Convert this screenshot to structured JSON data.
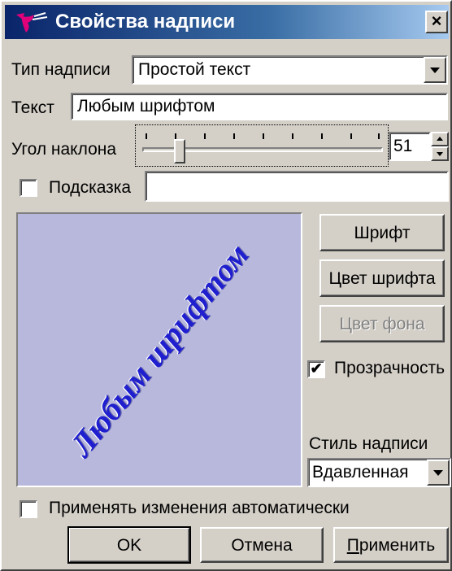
{
  "window": {
    "title": "Свойства надписи",
    "close_label": "×"
  },
  "label_type": {
    "label": "Тип надписи",
    "value": "Простой текст"
  },
  "text_field": {
    "label": "Текст",
    "value": "Любым шрифтом"
  },
  "angle": {
    "label": "Угол наклона",
    "value": "51",
    "slider_fraction": 0.14
  },
  "hint": {
    "label": "Подсказка",
    "checked": false,
    "value": ""
  },
  "preview": {
    "text": "Любым шрифтом",
    "background_color": "#b8b8dd",
    "text_color": "#1f1fcf"
  },
  "buttons": {
    "font": "Шрифт",
    "font_color": "Цвет шрифта",
    "bg_color": "Цвет фона",
    "ok": "OK",
    "cancel": "Отмена",
    "apply": "Применить"
  },
  "transparency": {
    "label": "Прозрачность",
    "checked": true
  },
  "style": {
    "label": "Стиль надписи",
    "value": "Вдавленная"
  },
  "auto_apply": {
    "label": "Применять изменения автоматически",
    "checked": false
  },
  "icons": {
    "title": "app-logo-icon",
    "dropdown": "chevron-down-icon",
    "spin_up": "spin-up-icon",
    "spin_down": "spin-down-icon",
    "check": "check-icon"
  }
}
